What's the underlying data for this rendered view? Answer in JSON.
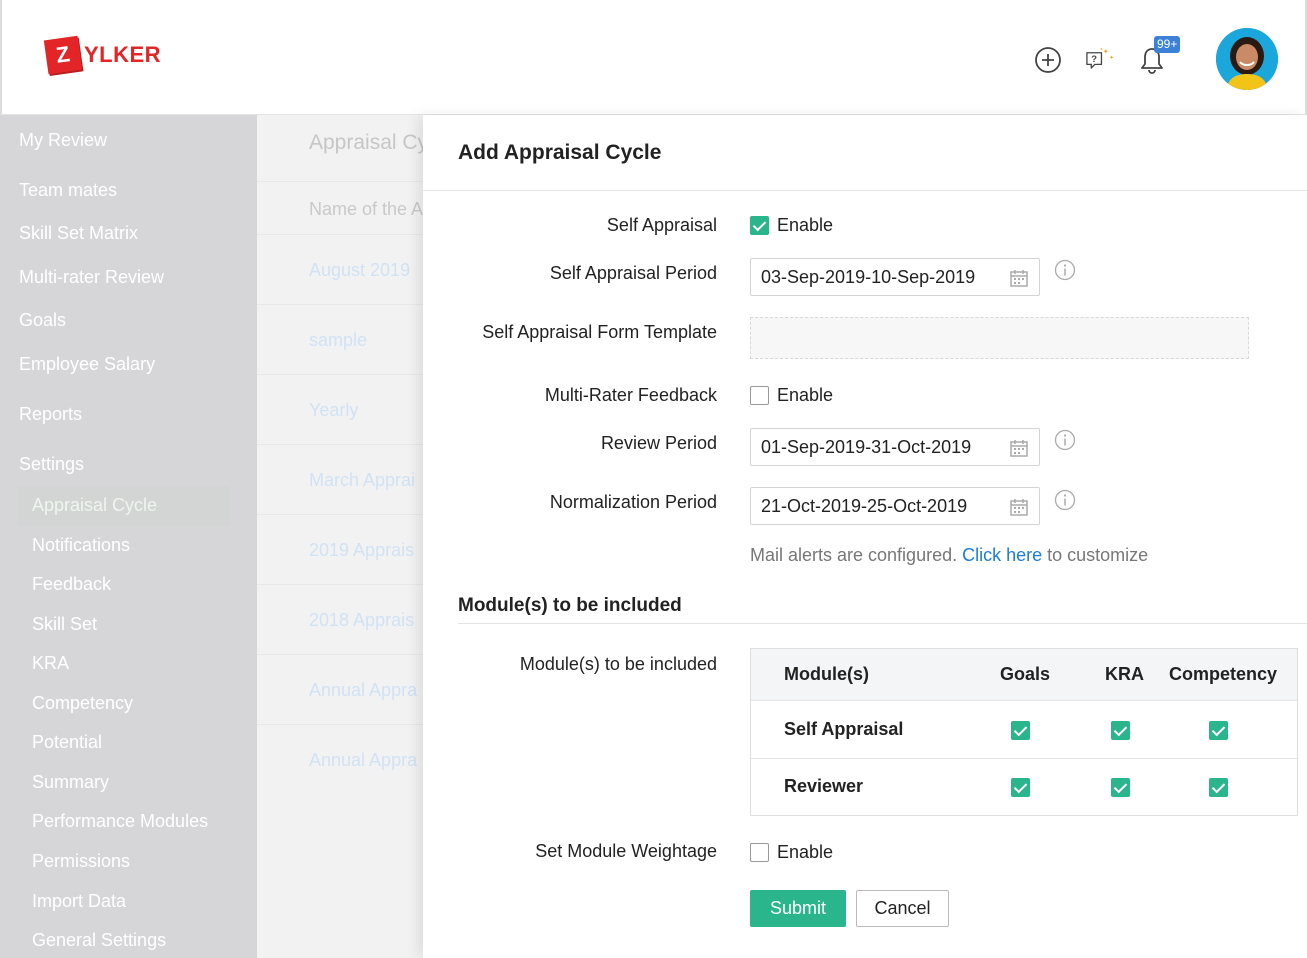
{
  "brand": {
    "logo_letter": "Z",
    "logo_text": "YLKER",
    "accent": "#e42527"
  },
  "header": {
    "icons": [
      "add-circle-icon",
      "help-icon",
      "notification-bell-icon"
    ],
    "notification_badge": "99+"
  },
  "sidebar": {
    "items": [
      {
        "label": "My Review"
      },
      {
        "label": "Team mates"
      },
      {
        "label": "Skill Set Matrix"
      },
      {
        "label": "Multi-rater Review"
      },
      {
        "label": "Goals"
      },
      {
        "label": "Employee Salary"
      },
      {
        "label": "Reports"
      },
      {
        "label": "Settings"
      }
    ],
    "settings_items": [
      {
        "label": "Appraisal Cycle",
        "active": true
      },
      {
        "label": "Notifications"
      },
      {
        "label": "Feedback"
      },
      {
        "label": "Skill Set"
      },
      {
        "label": "KRA"
      },
      {
        "label": "Competency"
      },
      {
        "label": "Potential"
      },
      {
        "label": "Summary"
      },
      {
        "label": "Performance Modules"
      },
      {
        "label": "Permissions"
      },
      {
        "label": "Import Data"
      },
      {
        "label": "General Settings"
      }
    ]
  },
  "background_list": {
    "title": "Appraisal Cy",
    "column_header": "Name of the A",
    "rows": [
      "August 2019",
      "sample",
      "Yearly",
      "March Apprai",
      "2019 Apprais",
      "2018 Apprais",
      "Annual Appra",
      "Annual Appra"
    ]
  },
  "panel": {
    "title": "Add Appraisal Cycle",
    "self_appraisal": {
      "label": "Self Appraisal",
      "enable_label": "Enable",
      "checked": true
    },
    "self_appraisal_period": {
      "label": "Self Appraisal Period",
      "value": "03-Sep-2019-10-Sep-2019"
    },
    "self_appraisal_template": {
      "label": "Self Appraisal Form Template",
      "value": ""
    },
    "multi_rater": {
      "label": "Multi-Rater Feedback",
      "enable_label": "Enable",
      "checked": false
    },
    "review_period": {
      "label": "Review Period",
      "value": "01-Sep-2019-31-Oct-2019"
    },
    "normalization_period": {
      "label": "Normalization Period",
      "value": "21-Oct-2019-25-Oct-2019"
    },
    "mail_note": {
      "prefix": "Mail alerts are configured. ",
      "link": "Click here",
      "suffix": " to customize"
    },
    "modules_section_title": "Module(s) to be included",
    "modules_label": "Module(s) to be included",
    "modules_table": {
      "headers": [
        "Module(s)",
        "Goals",
        "KRA",
        "Competency"
      ],
      "rows": [
        {
          "name": "Self Appraisal",
          "goals": true,
          "kra": true,
          "competency": true
        },
        {
          "name": "Reviewer",
          "goals": true,
          "kra": true,
          "competency": true
        }
      ]
    },
    "module_weightage": {
      "label": "Set Module Weightage",
      "enable_label": "Enable",
      "checked": false
    },
    "submit_label": "Submit",
    "cancel_label": "Cancel"
  },
  "colors": {
    "check_green": "#2bb58c",
    "link_blue": "#1a7dd6",
    "badge_blue": "#3b82d6"
  }
}
